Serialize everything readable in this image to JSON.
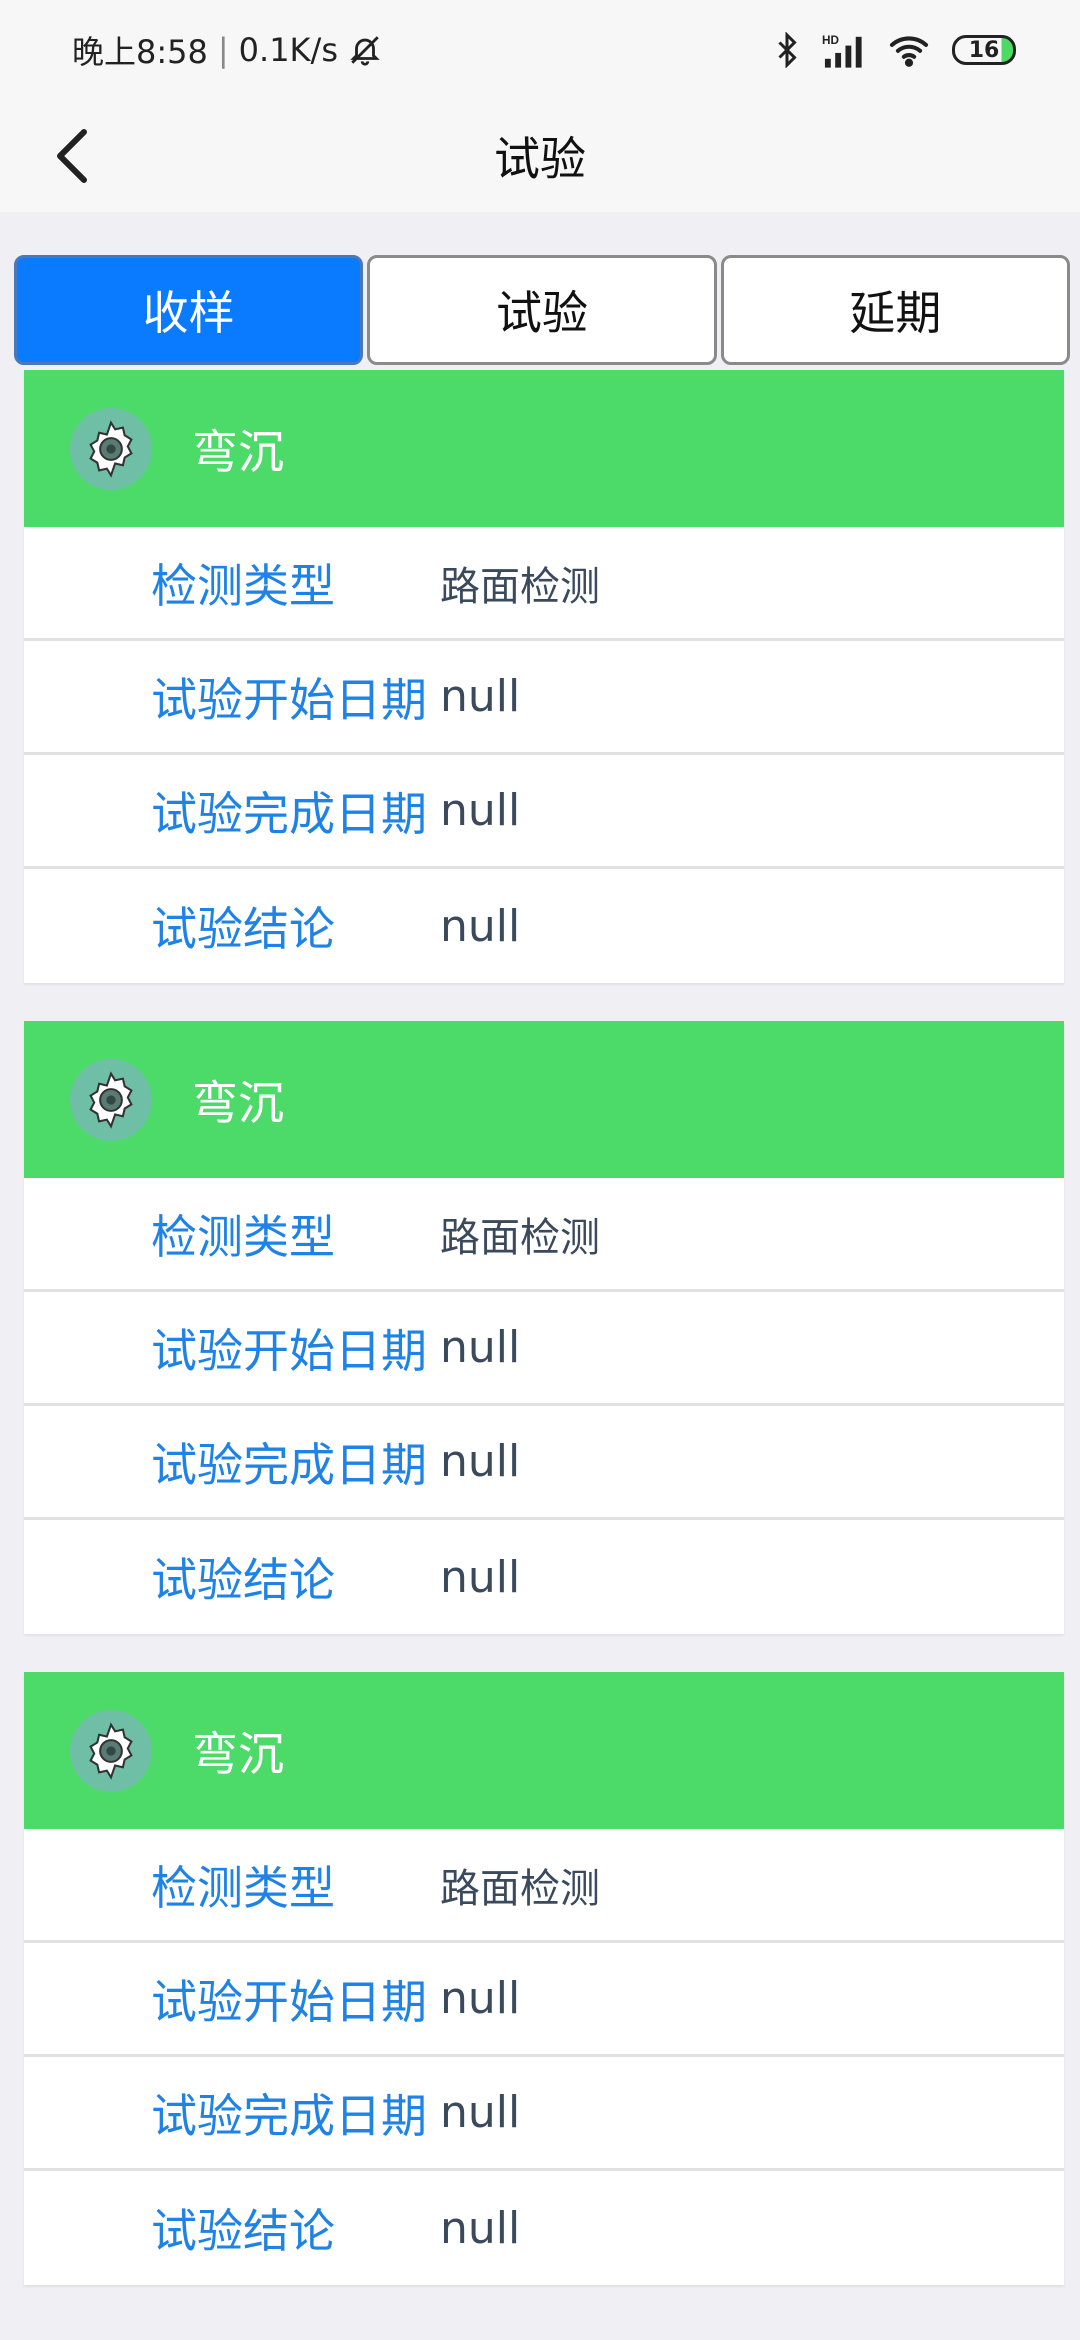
{
  "status_bar": {
    "time": "晚上8:58",
    "separator": "|",
    "net_speed": "0.1K/s",
    "icons": [
      "mute-bell-icon",
      "bluetooth-icon",
      "hd-signal-icon",
      "wifi-icon",
      "battery-icon"
    ],
    "battery_level": "16"
  },
  "nav": {
    "title": "试验",
    "back_icon": "chevron-left-icon"
  },
  "tabs": [
    {
      "label": "收样",
      "active": true
    },
    {
      "label": "试验",
      "active": false
    },
    {
      "label": "延期",
      "active": false
    }
  ],
  "colors": {
    "accent": "#0a7bff",
    "card_header": "#4cdb68",
    "label_text": "#1e82e6",
    "value_text": "#3a4a5c"
  },
  "cards": [
    {
      "title": "弯沉",
      "icon": "gear-icon",
      "rows": [
        {
          "label": "检测类型",
          "value": "路面检测"
        },
        {
          "label": "试验开始日期",
          "value": "null"
        },
        {
          "label": "试验完成日期",
          "value": "null"
        },
        {
          "label": "试验结论",
          "value": "null"
        }
      ]
    },
    {
      "title": "弯沉",
      "icon": "gear-icon",
      "rows": [
        {
          "label": "检测类型",
          "value": "路面检测"
        },
        {
          "label": "试验开始日期",
          "value": "null"
        },
        {
          "label": "试验完成日期",
          "value": "null"
        },
        {
          "label": "试验结论",
          "value": "null"
        }
      ]
    },
    {
      "title": "弯沉",
      "icon": "gear-icon",
      "rows": [
        {
          "label": "检测类型",
          "value": "路面检测"
        },
        {
          "label": "试验开始日期",
          "value": "null"
        },
        {
          "label": "试验完成日期",
          "value": "null"
        },
        {
          "label": "试验结论",
          "value": "null"
        }
      ]
    }
  ]
}
